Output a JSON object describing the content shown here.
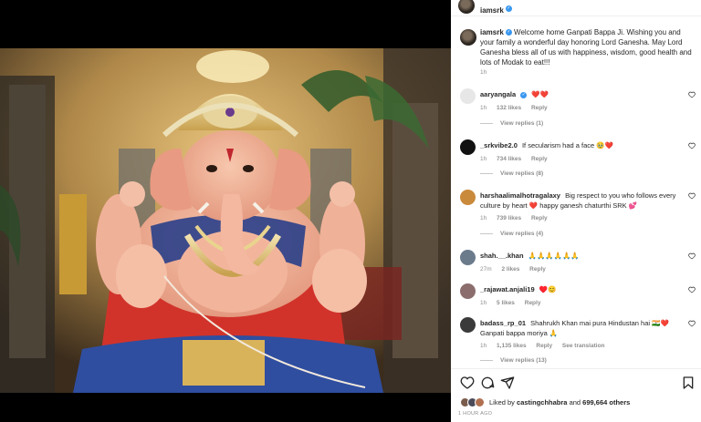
{
  "post": {
    "author": "iamsrk",
    "image_alt": "Ganpati idol"
  },
  "caption": {
    "username": "iamsrk",
    "text": "Welcome home Ganpati Bappa Ji. Wishing you and your family a wonderful day honoring Lord Ganesha. May Lord Ganesha bless all of us with happiness, wisdom, good health and lots of Modak to eat!!!",
    "time": "1h"
  },
  "comments": [
    {
      "username": "aaryangala",
      "verified": true,
      "text": "❤️❤️",
      "time": "1h",
      "likes": "132 likes",
      "reply": "Reply",
      "view_replies": "View replies (1)",
      "avatar_color": "#e7e7e7"
    },
    {
      "username": "_srkvibe2.0",
      "verified": false,
      "text": "If secularism had a face 🥹❤️",
      "time": "1h",
      "likes": "734 likes",
      "reply": "Reply",
      "view_replies": "View replies (8)",
      "avatar_color": "#111111"
    },
    {
      "username": "harshaalimalhotragalaxy",
      "verified": false,
      "text": "Big respect to you who follows every culture by heart ❤️ happy ganesh chaturthi SRK 💕",
      "time": "1h",
      "likes": "739 likes",
      "reply": "Reply",
      "view_replies": "View replies (4)",
      "avatar_color": "#c98a3c"
    },
    {
      "username": "shah.__.khan",
      "verified": false,
      "text": "🙏🙏🙏🙏🙏🙏",
      "time": "27m",
      "likes": "2 likes",
      "reply": "Reply",
      "view_replies": "",
      "avatar_color": "#6b7b8c"
    },
    {
      "username": "_rajawat.anjali19",
      "verified": false,
      "text": "♥️😊",
      "time": "1h",
      "likes": "5 likes",
      "reply": "Reply",
      "view_replies": "",
      "avatar_color": "#8c6d6d"
    },
    {
      "username": "badass_rp_01",
      "verified": false,
      "text": "Shahrukh Khan mai pura Hindustan hai 🇮🇳❤️ Ganpati bappa moriya 🙏",
      "time": "1h",
      "likes": "1,135 likes",
      "reply": "Reply",
      "see_translation": "See translation",
      "view_replies": "View replies (13)",
      "avatar_color": "#3a3a3a"
    }
  ],
  "liked_by": {
    "prefix": "Liked by",
    "user": "castingchhabra",
    "conj": "and",
    "count": "699,664 others"
  },
  "posted_ago": "1 HOUR AGO",
  "colors": {
    "verified": "#3897f0",
    "heart": "#ed4956",
    "muted": "#8e8e8e",
    "text": "#262626"
  },
  "icons": [
    "heart-icon",
    "comment-icon",
    "share-icon",
    "bookmark-icon"
  ]
}
